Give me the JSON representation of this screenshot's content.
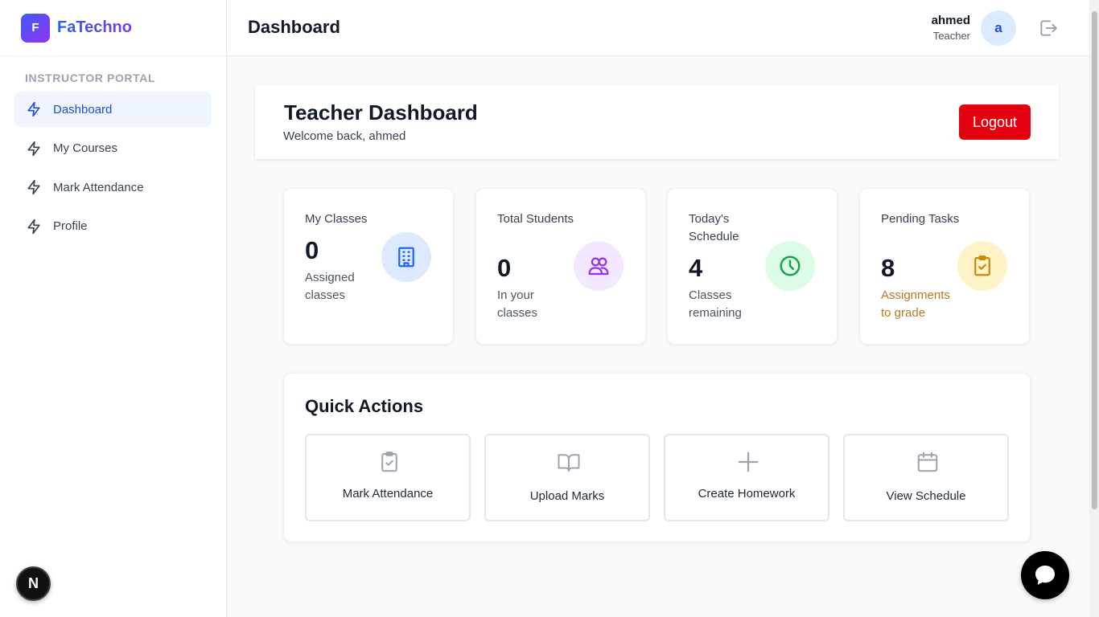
{
  "brand": {
    "logo_letter": "F",
    "name": "FaTechno"
  },
  "sidebar": {
    "section_label": "INSTRUCTOR PORTAL",
    "items": [
      {
        "label": "Dashboard",
        "active": true,
        "icon": "bolt-icon"
      },
      {
        "label": "My Courses",
        "active": false,
        "icon": "bolt-icon"
      },
      {
        "label": "Mark Attendance",
        "active": false,
        "icon": "bolt-icon"
      },
      {
        "label": "Profile",
        "active": false,
        "icon": "bolt-icon"
      }
    ]
  },
  "topbar": {
    "title": "Dashboard",
    "user_name": "ahmed",
    "user_role": "Teacher",
    "avatar_letter": "a"
  },
  "header": {
    "title": "Teacher Dashboard",
    "subtitle": "Welcome back, ahmed",
    "logout_label": "Logout"
  },
  "stats": [
    {
      "label": "My Classes",
      "value": "0",
      "note": "Assigned classes",
      "icon": "building-icon",
      "icon_bg": "#dbeafe",
      "icon_color": "#2563eb"
    },
    {
      "label": "Total Students",
      "value": "0",
      "note": "In your classes",
      "icon": "users-icon",
      "icon_bg": "#f3e8ff",
      "icon_color": "#9333ea"
    },
    {
      "label": "Today's Schedule",
      "value": "4",
      "note": "Classes remaining",
      "icon": "clock-icon",
      "icon_bg": "#dcfce7",
      "icon_color": "#16a34a"
    },
    {
      "label": "Pending Tasks",
      "value": "8",
      "note": "Assignments to grade",
      "icon": "clipboard-check-icon",
      "icon_bg": "#fef3c7",
      "icon_color": "#ca8a04",
      "note_color": "#b7791f"
    }
  ],
  "quick_actions": {
    "title": "Quick Actions",
    "items": [
      {
        "label": "Mark Attendance",
        "icon": "clipboard-check-icon"
      },
      {
        "label": "Upload Marks",
        "icon": "book-open-icon"
      },
      {
        "label": "Create Homework",
        "icon": "plus-icon"
      },
      {
        "label": "View Schedule",
        "icon": "calendar-icon"
      }
    ]
  },
  "misc": {
    "framework_badge": "N",
    "chat_icon": "chat-bubble-icon"
  }
}
